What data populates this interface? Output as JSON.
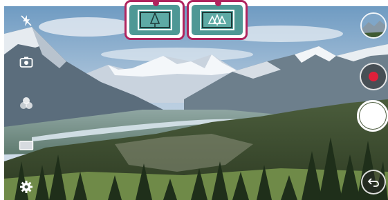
{
  "app": {
    "name": "Camera"
  },
  "lens_selector": {
    "options": [
      {
        "id": "standard",
        "icon": "single-tree-icon",
        "selected": true
      },
      {
        "id": "wide",
        "icon": "three-trees-icon",
        "selected": false
      }
    ],
    "highlight_color": "#b0245e",
    "button_color": "#4e9895"
  },
  "left_toolbar": {
    "icons": [
      "flash-off-icon",
      "switch-camera-icon",
      "filter-icon",
      "aspect-ratio-icon",
      "settings-gear-icon"
    ]
  },
  "right_toolbar": {
    "icons": [
      "gallery-thumbnail",
      "record-video-icon",
      "shutter-button",
      "back-arrow-icon"
    ],
    "record_color": "#e0203a"
  }
}
